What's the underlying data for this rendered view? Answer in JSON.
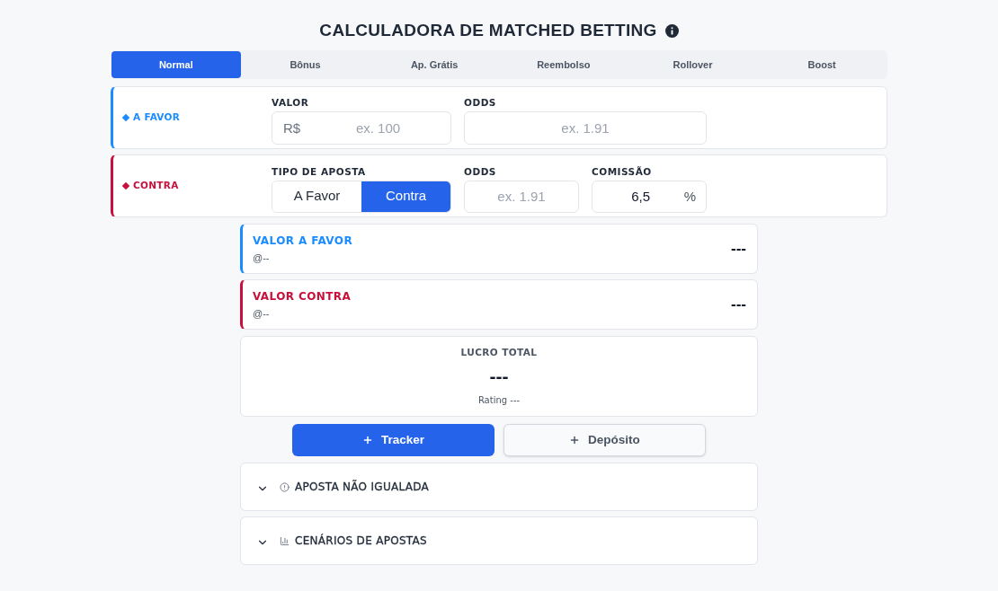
{
  "header": {
    "title": "CALCULADORA DE MATCHED BETTING"
  },
  "tabs": [
    {
      "label": "Normal",
      "selected": true
    },
    {
      "label": "Bônus",
      "selected": false
    },
    {
      "label": "Ap. Grátis",
      "selected": false
    },
    {
      "label": "Reembolso",
      "selected": false
    },
    {
      "label": "Rollover",
      "selected": false
    },
    {
      "label": "Boost",
      "selected": false
    }
  ],
  "bets": [
    {
      "label": "A FAVOR",
      "color": "#1a8cff",
      "fields": [
        {
          "kind": "currency",
          "label": "VALOR",
          "prefix": "R$",
          "placeholder": "ex. 100"
        },
        {
          "kind": "text",
          "label": "ODDS",
          "placeholder": "ex. 1.91"
        }
      ]
    },
    {
      "label": "CONTRA",
      "color": "#c8103c",
      "fields": [
        {
          "kind": "toggle",
          "label": "TIPO DE APOSTA",
          "options": [
            {
              "label": "A Favor",
              "selected": false
            },
            {
              "label": "Contra",
              "selected": true
            }
          ]
        },
        {
          "kind": "text",
          "label": "ODDS",
          "placeholder": "ex. 1.91"
        },
        {
          "kind": "percent",
          "label": "COMISSÃO",
          "value": "6,5",
          "suffix": "%"
        }
      ]
    }
  ],
  "results": [
    {
      "label": "VALOR A FAVOR",
      "odds": "@--",
      "amount": "---",
      "color": "#1a8cff"
    },
    {
      "label": "VALOR CONTRA",
      "odds": "@--",
      "amount": "---",
      "color": "#c8103c"
    }
  ],
  "total": {
    "label": "LUCRO TOTAL",
    "value": "---",
    "rating": "Rating ---"
  },
  "actions": [
    {
      "kind": "primary",
      "label": "Tracker"
    },
    {
      "kind": "secondary",
      "label": "Depósito"
    }
  ],
  "sections": [
    {
      "kind": "alert",
      "label": "APOSTA NÃO IGUALADA",
      "expanded": false
    },
    {
      "kind": "chart",
      "label": "CENÁRIOS DE APOSTAS",
      "expanded": false
    }
  ]
}
